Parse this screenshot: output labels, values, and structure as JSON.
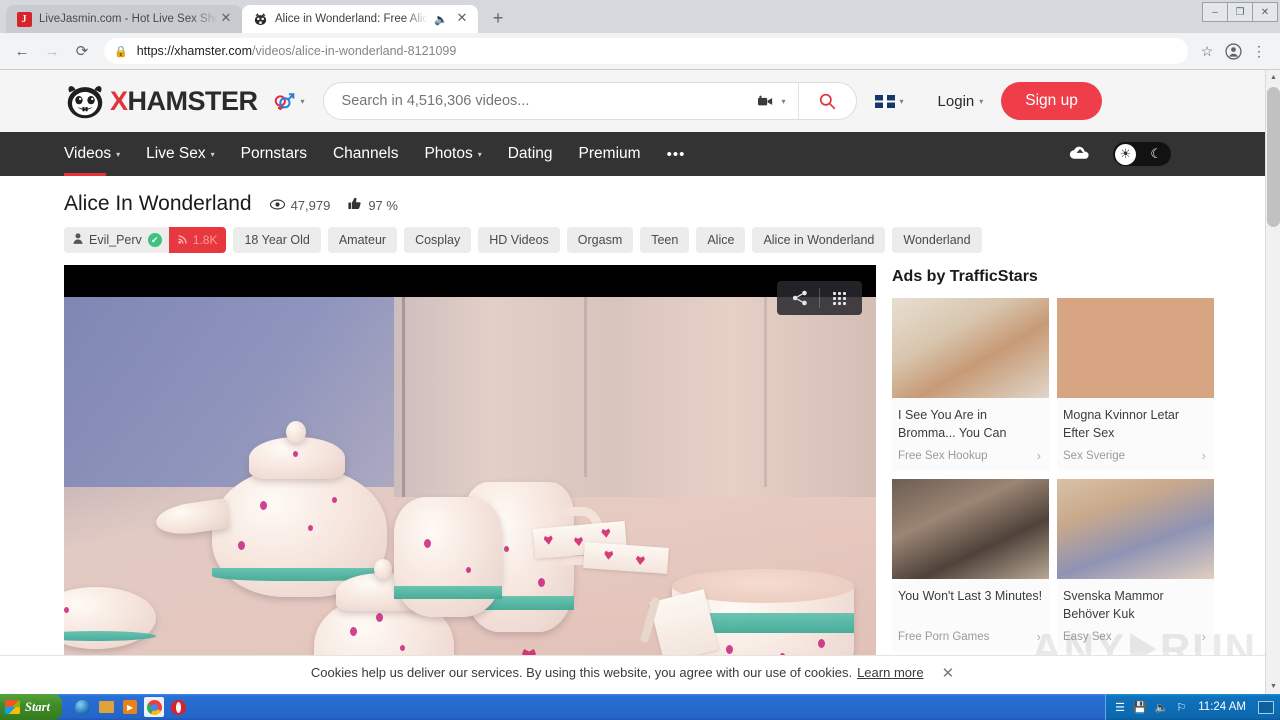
{
  "browser": {
    "tabs": [
      {
        "title": "LiveJasmin.com - Hot Live Sex Show",
        "favicon": "J",
        "active": false,
        "audio": false
      },
      {
        "title": "Alice in Wonderland: Free Alice",
        "favicon": "hamster-icon",
        "active": true,
        "audio": true
      }
    ],
    "new_tab_label": "+",
    "window_controls": {
      "minimize": "–",
      "maximize": "❐",
      "close": "✕"
    },
    "nav": {
      "back": "←",
      "forward": "→",
      "reload": "⟳"
    },
    "url": {
      "lock": "🔒",
      "domain": "https://xhamster.com",
      "path": "/videos/alice-in-wonderland-8121099"
    },
    "omni_icons": {
      "bookmark": "☆",
      "profile": "profile-icon",
      "menu": "⋮"
    }
  },
  "site": {
    "logo": {
      "x": "X",
      "word": "HAMSTER"
    },
    "gender_selector": {
      "icon": "gender-symbols-icon",
      "caret": "▾"
    },
    "search": {
      "placeholder": "Search in 4,516,306 videos...",
      "value": "",
      "camera_icon": "camera-icon",
      "caret": "▾",
      "search_icon": "search-icon"
    },
    "language": {
      "flag": "uk-flag-icon",
      "caret": "▾"
    },
    "login_label": "Login",
    "login_caret": "▾",
    "signup_label": "Sign up",
    "nav_items": [
      {
        "label": "Videos",
        "caret": "▾",
        "active": true
      },
      {
        "label": "Live Sex",
        "caret": "▾",
        "active": false
      },
      {
        "label": "Pornstars",
        "caret": "",
        "active": false
      },
      {
        "label": "Channels",
        "caret": "",
        "active": false
      },
      {
        "label": "Photos",
        "caret": "▾",
        "active": false
      },
      {
        "label": "Dating",
        "caret": "",
        "active": false
      },
      {
        "label": "Premium",
        "caret": "",
        "active": false
      }
    ],
    "nav_more": "•••",
    "nav_upload_icon": "upload-cloud-icon",
    "theme_toggle": {
      "sun": "☀",
      "moon": "☾"
    }
  },
  "video": {
    "title": "Alice In Wonderland",
    "views": "47,979",
    "views_icon": "eye-icon",
    "rating": "97 %",
    "rating_icon": "thumbs-up-icon",
    "uploader": {
      "name": "Evil_Perv",
      "person_icon": "person-icon",
      "verified_icon": "✔",
      "subscribers": "1.8K",
      "rss_icon": "rss-icon"
    },
    "tags": [
      "18 Year Old",
      "Amateur",
      "Cosplay",
      "HD Videos",
      "Orgasm",
      "Teen",
      "Alice",
      "Alice in Wonderland",
      "Wonderland"
    ],
    "player_overlay": {
      "share_icon": "share-icon",
      "grid_icon": "grid-icon"
    }
  },
  "ads": {
    "heading": "Ads by TrafficStars",
    "items": [
      {
        "title": "I See You Are in Bromma... You Can",
        "source": "Free Sex Hookup",
        "arrow": "›"
      },
      {
        "title": "Mogna Kvinnor Letar Efter Sex",
        "source": "Sex Sverige",
        "arrow": "›"
      },
      {
        "title": "You Won't Last 3 Minutes!",
        "source": "Free Porn Games",
        "arrow": "›"
      },
      {
        "title": "Svenska Mammor Behöver Kuk",
        "source": "Easy Sex",
        "arrow": "›"
      }
    ]
  },
  "watermark": {
    "left": "ANY",
    "right": "RUN"
  },
  "cookie_bar": {
    "text": "Cookies help us deliver our services. By using this website, you agree with our use of cookies.",
    "link": "Learn more",
    "close": "✕"
  },
  "scrollbar": {
    "up": "▲",
    "down": "▼"
  },
  "taskbar": {
    "start_label": "Start",
    "quicklaunch": [
      "internet-explorer-icon",
      "folder-icon",
      "media-player-icon",
      "chrome-icon",
      "opera-icon"
    ],
    "tray_icons": [
      "pin-icon",
      "removable-drive-icon",
      "volume-icon",
      "network-flag-icon"
    ],
    "clock": "11:24 AM"
  },
  "colors": {
    "brand_red": "#e53138",
    "signup_red": "#ef3e4a",
    "nav_dark": "#333333",
    "verified_green": "#3dc37d"
  }
}
